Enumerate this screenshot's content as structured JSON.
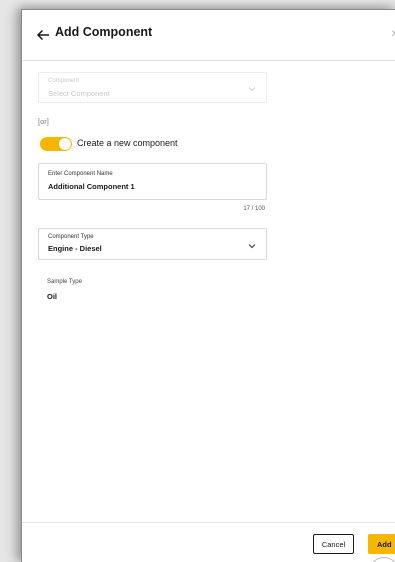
{
  "header": {
    "title": "Add Component",
    "back_icon": "arrow-left-icon",
    "close_icon": "close-icon"
  },
  "component_select": {
    "label": "Component",
    "placeholder": "Select Component",
    "disabled": true
  },
  "or_text": "[or]",
  "toggle": {
    "label": "Create a new component",
    "on": true
  },
  "name_field": {
    "label": "Enter Component Name",
    "value": "Additional Component 1",
    "counter": "17 / 100"
  },
  "type_select": {
    "label": "Component Type",
    "value": "Engine - Diesel"
  },
  "sample_type": {
    "label": "Sample Type",
    "value": "Oil"
  },
  "footer": {
    "cancel_label": "Cancel",
    "add_label": "Add"
  },
  "fab": {
    "label": "+"
  },
  "colors": {
    "accent": "#f5b700",
    "text": "#1a1a1a",
    "border": "#d8d8d8",
    "disabled_text": "#c9c9c9"
  }
}
